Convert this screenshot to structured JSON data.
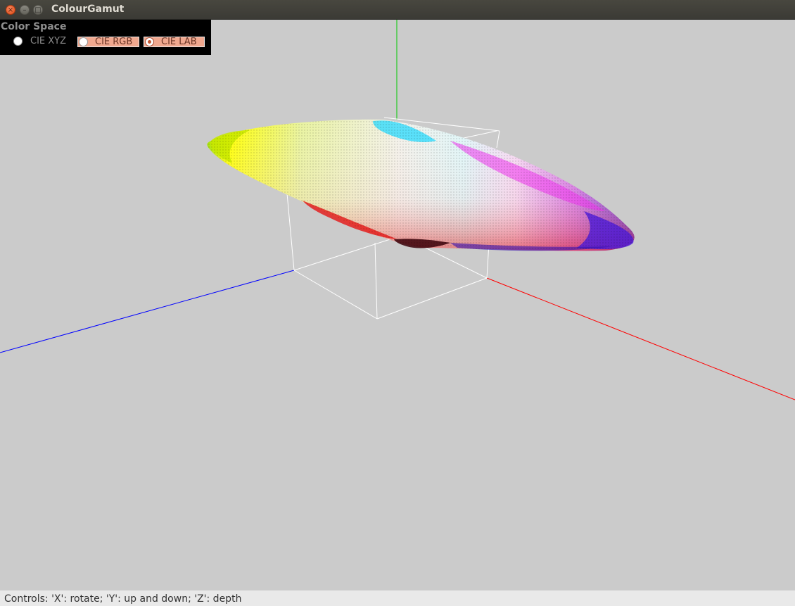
{
  "window": {
    "title": "ColourGamut"
  },
  "panel": {
    "title": "Color Space",
    "options": [
      {
        "label": "CIE XYZ",
        "selected": false
      },
      {
        "label": "CIE RGB",
        "selected": false
      },
      {
        "label": "CIE LAB",
        "selected": true
      }
    ]
  },
  "status": {
    "text": "Controls: 'X': rotate; 'Y': up and down; 'Z': depth"
  },
  "colors": {
    "canvas_bg": "#cbcbcb",
    "axis_x": "#ff0000",
    "axis_y": "#00c800",
    "axis_z": "#0000ff",
    "bounding_box": "#ffffff",
    "selected_option_bg": "#f0a88f"
  }
}
